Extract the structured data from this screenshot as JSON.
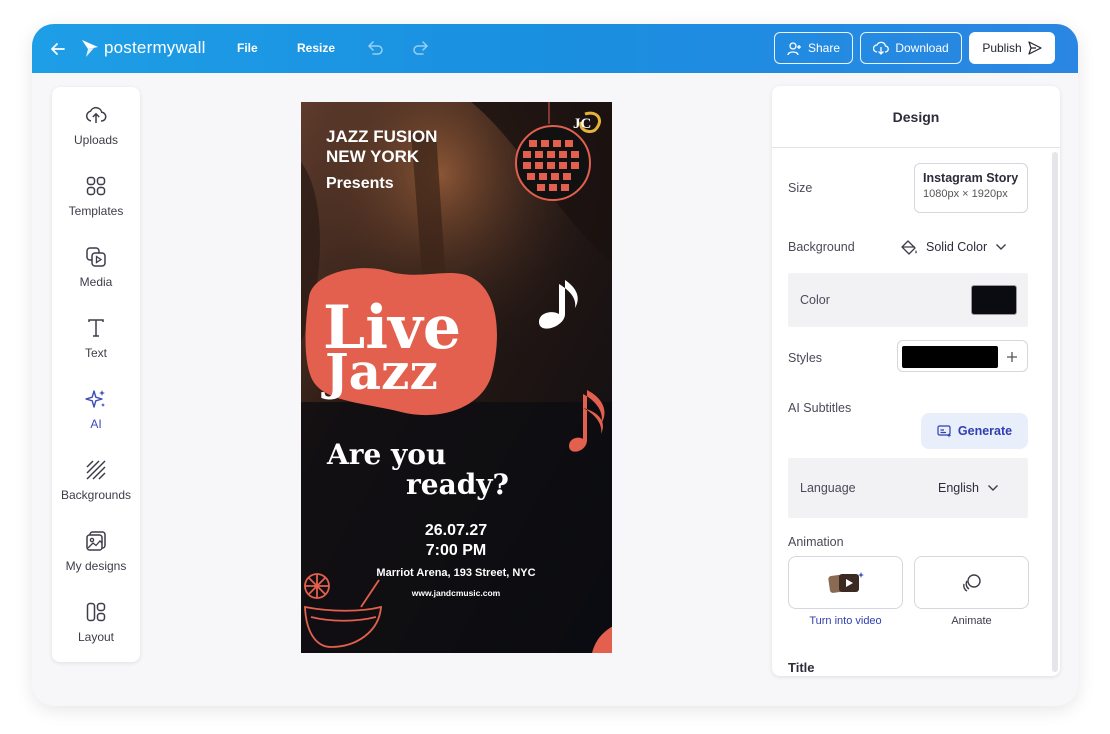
{
  "app": {
    "logo_text": "postermywall"
  },
  "topbar": {
    "menu": [
      "File",
      "Resize"
    ],
    "share_label": "Share",
    "download_label": "Download",
    "publish_label": "Publish"
  },
  "tools": [
    {
      "label": "Uploads",
      "icon": "upload-cloud-icon"
    },
    {
      "label": "Templates",
      "icon": "templates-grid-icon"
    },
    {
      "label": "Media",
      "icon": "media-icon"
    },
    {
      "label": "Text",
      "icon": "text-icon"
    },
    {
      "label": "AI",
      "icon": "sparkle-icon"
    },
    {
      "label": "Backgrounds",
      "icon": "backgrounds-icon"
    },
    {
      "label": "My designs",
      "icon": "my-designs-icon"
    },
    {
      "label": "Layout",
      "icon": "layout-icon"
    }
  ],
  "poster": {
    "header_line1": "JAZZ FUSION",
    "header_line2": "NEW YORK",
    "header_line3": "Presents",
    "logo": "JC",
    "title_line1": "Live",
    "title_line2": "Jazz",
    "question_line1": "Are you",
    "question_line2": "ready?",
    "date": "26.07.27",
    "time": "7:00 PM",
    "venue": "Marriot Arena, 193 Street, NYC",
    "website": "www.jandcmusic.com"
  },
  "design_panel": {
    "title": "Design",
    "size_label": "Size",
    "size_name": "Instagram Story",
    "size_dims": "1080px × 1920px",
    "background_label": "Background",
    "background_value": "Solid Color",
    "color_label": "Color",
    "color_value": "#0b0c12",
    "styles_label": "Styles",
    "ai_subtitles_label": "AI Subtitles",
    "generate_label": "Generate",
    "language_label": "Language",
    "language_value": "English",
    "animation_label": "Animation",
    "turn_into_video_label": "Turn into video",
    "animate_label": "Animate",
    "title_section_label": "Title"
  },
  "colors": {
    "topbar": "#1e9ee6",
    "accent_blob": "#e2604d",
    "active_tool": "#3b4bb8"
  }
}
